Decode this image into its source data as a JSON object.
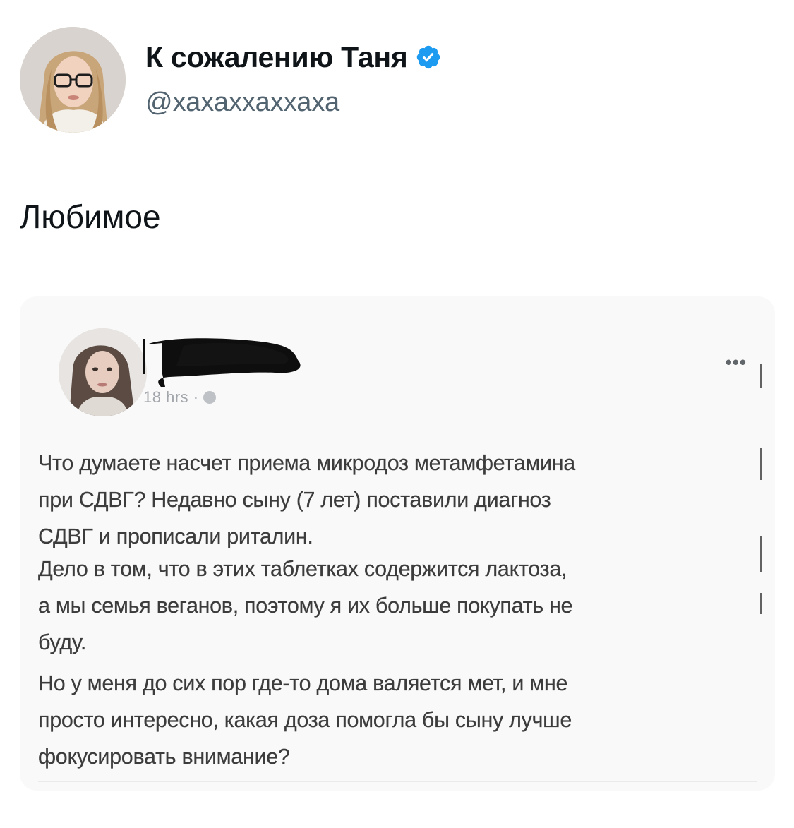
{
  "tweet": {
    "author_name": "К сожалению Таня",
    "author_handle": "@хахаххаххаха",
    "text": "Любимое"
  },
  "embedded_post": {
    "time": "18 hrs ·",
    "menu": "•••",
    "paragraphs": [
      {
        "lines": [
          "Что думаете насчет приема микродоз метамфетамина",
          "при СДВГ? Недавно сыну (7 лет) поставили диагноз",
          "СДВГ и прописали риталин."
        ]
      },
      {
        "lines": [
          "Дело в том, что в этих таблетках содержится лактоза,",
          "а мы семья веганов, поэтому я их больше покупать не",
          "буду."
        ]
      },
      {
        "lines": [
          "Но у меня до сих пор где-то дома валяется мет, и мне",
          "просто интересно, какая доза помогла бы сыну лучше",
          "фокусировать внимание?"
        ]
      }
    ]
  },
  "colors": {
    "text_primary": "#0f1419",
    "text_secondary": "#536471",
    "verified_badge": "#1d9bf0",
    "post_text": "#3b3b3b"
  }
}
